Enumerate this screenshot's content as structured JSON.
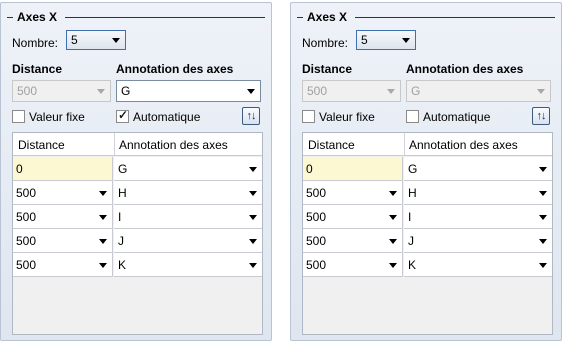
{
  "panels": [
    {
      "title": "Axes X",
      "nombre_label": "Nombre:",
      "nombre_value": "5",
      "distance_label": "Distance",
      "distance_value": "500",
      "annotation_label": "Annotation des axes",
      "annotation_value": "G",
      "annotation_enabled": true,
      "valeur_fixe_label": "Valeur fixe",
      "valeur_fixe_checked": false,
      "automatique_label": "Automatique",
      "automatique_checked": true,
      "sort_icon": "sort-arrows-icon",
      "table": {
        "columns": [
          "Distance",
          "Annotation des axes"
        ],
        "rows": [
          {
            "distance": "0",
            "annotation": "G",
            "distance_dropdown": false
          },
          {
            "distance": "500",
            "annotation": "H",
            "distance_dropdown": true
          },
          {
            "distance": "500",
            "annotation": "I",
            "distance_dropdown": true
          },
          {
            "distance": "500",
            "annotation": "J",
            "distance_dropdown": true
          },
          {
            "distance": "500",
            "annotation": "K",
            "distance_dropdown": true
          }
        ]
      }
    },
    {
      "title": "Axes X",
      "nombre_label": "Nombre:",
      "nombre_value": "5",
      "distance_label": "Distance",
      "distance_value": "500",
      "annotation_label": "Annotation des axes",
      "annotation_value": "G",
      "annotation_enabled": false,
      "valeur_fixe_label": "Valeur fixe",
      "valeur_fixe_checked": false,
      "automatique_label": "Automatique",
      "automatique_checked": false,
      "sort_icon": "sort-arrows-icon",
      "table": {
        "columns": [
          "Distance",
          "Annotation des axes"
        ],
        "rows": [
          {
            "distance": "0",
            "annotation": "G",
            "distance_dropdown": false
          },
          {
            "distance": "500",
            "annotation": "H",
            "distance_dropdown": true
          },
          {
            "distance": "500",
            "annotation": "I",
            "distance_dropdown": true
          },
          {
            "distance": "500",
            "annotation": "J",
            "distance_dropdown": true
          },
          {
            "distance": "500",
            "annotation": "K",
            "distance_dropdown": true
          }
        ]
      }
    }
  ]
}
